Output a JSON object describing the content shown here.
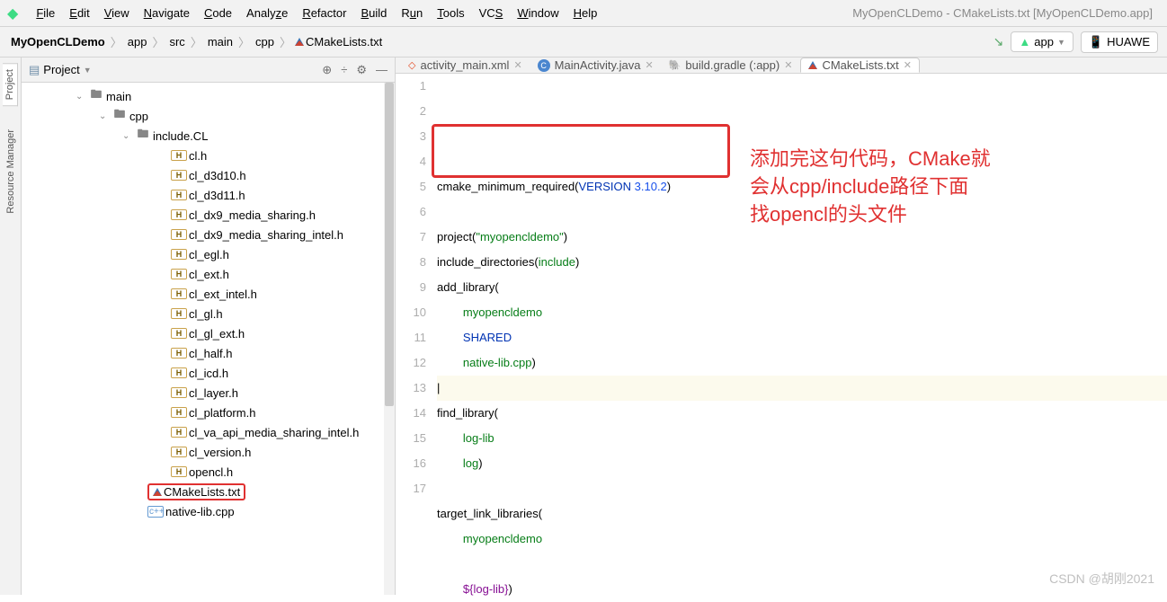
{
  "window_title": "MyOpenCLDemo - CMakeLists.txt [MyOpenCLDemo.app]",
  "menu": [
    "File",
    "Edit",
    "View",
    "Navigate",
    "Code",
    "Analyze",
    "Refactor",
    "Build",
    "Run",
    "Tools",
    "VCS",
    "Window",
    "Help"
  ],
  "breadcrumb": [
    "MyOpenCLDemo",
    "app",
    "src",
    "main",
    "cpp",
    "CMakeLists.txt"
  ],
  "run_config": "app",
  "device": "HUAWE",
  "side_tabs": {
    "project": "Project",
    "resource": "Resource Manager"
  },
  "pane_title": "Project",
  "tree": {
    "main": "main",
    "cpp": "cpp",
    "include": "include.CL",
    "files": [
      "cl.h",
      "cl_d3d10.h",
      "cl_d3d11.h",
      "cl_dx9_media_sharing.h",
      "cl_dx9_media_sharing_intel.h",
      "cl_egl.h",
      "cl_ext.h",
      "cl_ext_intel.h",
      "cl_gl.h",
      "cl_gl_ext.h",
      "cl_half.h",
      "cl_icd.h",
      "cl_layer.h",
      "cl_platform.h",
      "cl_va_api_media_sharing_intel.h",
      "cl_version.h",
      "opencl.h"
    ],
    "cmake": "CMakeLists.txt",
    "native": "native-lib.cpp"
  },
  "tabs": [
    {
      "label": "activity_main.xml",
      "icon": "xml",
      "active": false
    },
    {
      "label": "MainActivity.java",
      "icon": "java",
      "active": false
    },
    {
      "label": "build.gradle (:app)",
      "icon": "gradle",
      "active": false
    },
    {
      "label": "CMakeLists.txt",
      "icon": "cmake",
      "active": true
    }
  ],
  "code": {
    "lines": [
      {
        "n": 1,
        "html": "cmake_minimum_required(<span class='kw'>VERSION</span> <span class='num'>3.10.2</span>)"
      },
      {
        "n": 2,
        "html": ""
      },
      {
        "n": 3,
        "html": "project(<span class='str'>\"myopencldemo\"</span>)"
      },
      {
        "n": 4,
        "html": "include_directories(<span class='str'>include</span>)"
      },
      {
        "n": 5,
        "html": "add_library("
      },
      {
        "n": 6,
        "html": "        <span class='str'>myopencldemo</span>"
      },
      {
        "n": 7,
        "html": "        <span class='kw'>SHARED</span>"
      },
      {
        "n": 8,
        "html": "        <span class='str'>native-lib.cpp</span>)"
      },
      {
        "n": 9,
        "html": "|",
        "current": true
      },
      {
        "n": 10,
        "html": "find_library("
      },
      {
        "n": 11,
        "html": "        <span class='str'>log-lib</span>"
      },
      {
        "n": 12,
        "html": "        <span class='str'>log</span>)"
      },
      {
        "n": 13,
        "html": ""
      },
      {
        "n": 14,
        "html": "target_link_libraries("
      },
      {
        "n": 15,
        "html": "        <span class='str'>myopencldemo</span>"
      },
      {
        "n": 16,
        "html": ""
      },
      {
        "n": 17,
        "html": "        <span class='var'>${log-lib}</span>)"
      }
    ]
  },
  "annotation": "添加完这句代码，CMake就\n会从cpp/include路径下面\n找opencl的头文件",
  "watermark": "CSDN @胡刚2021"
}
